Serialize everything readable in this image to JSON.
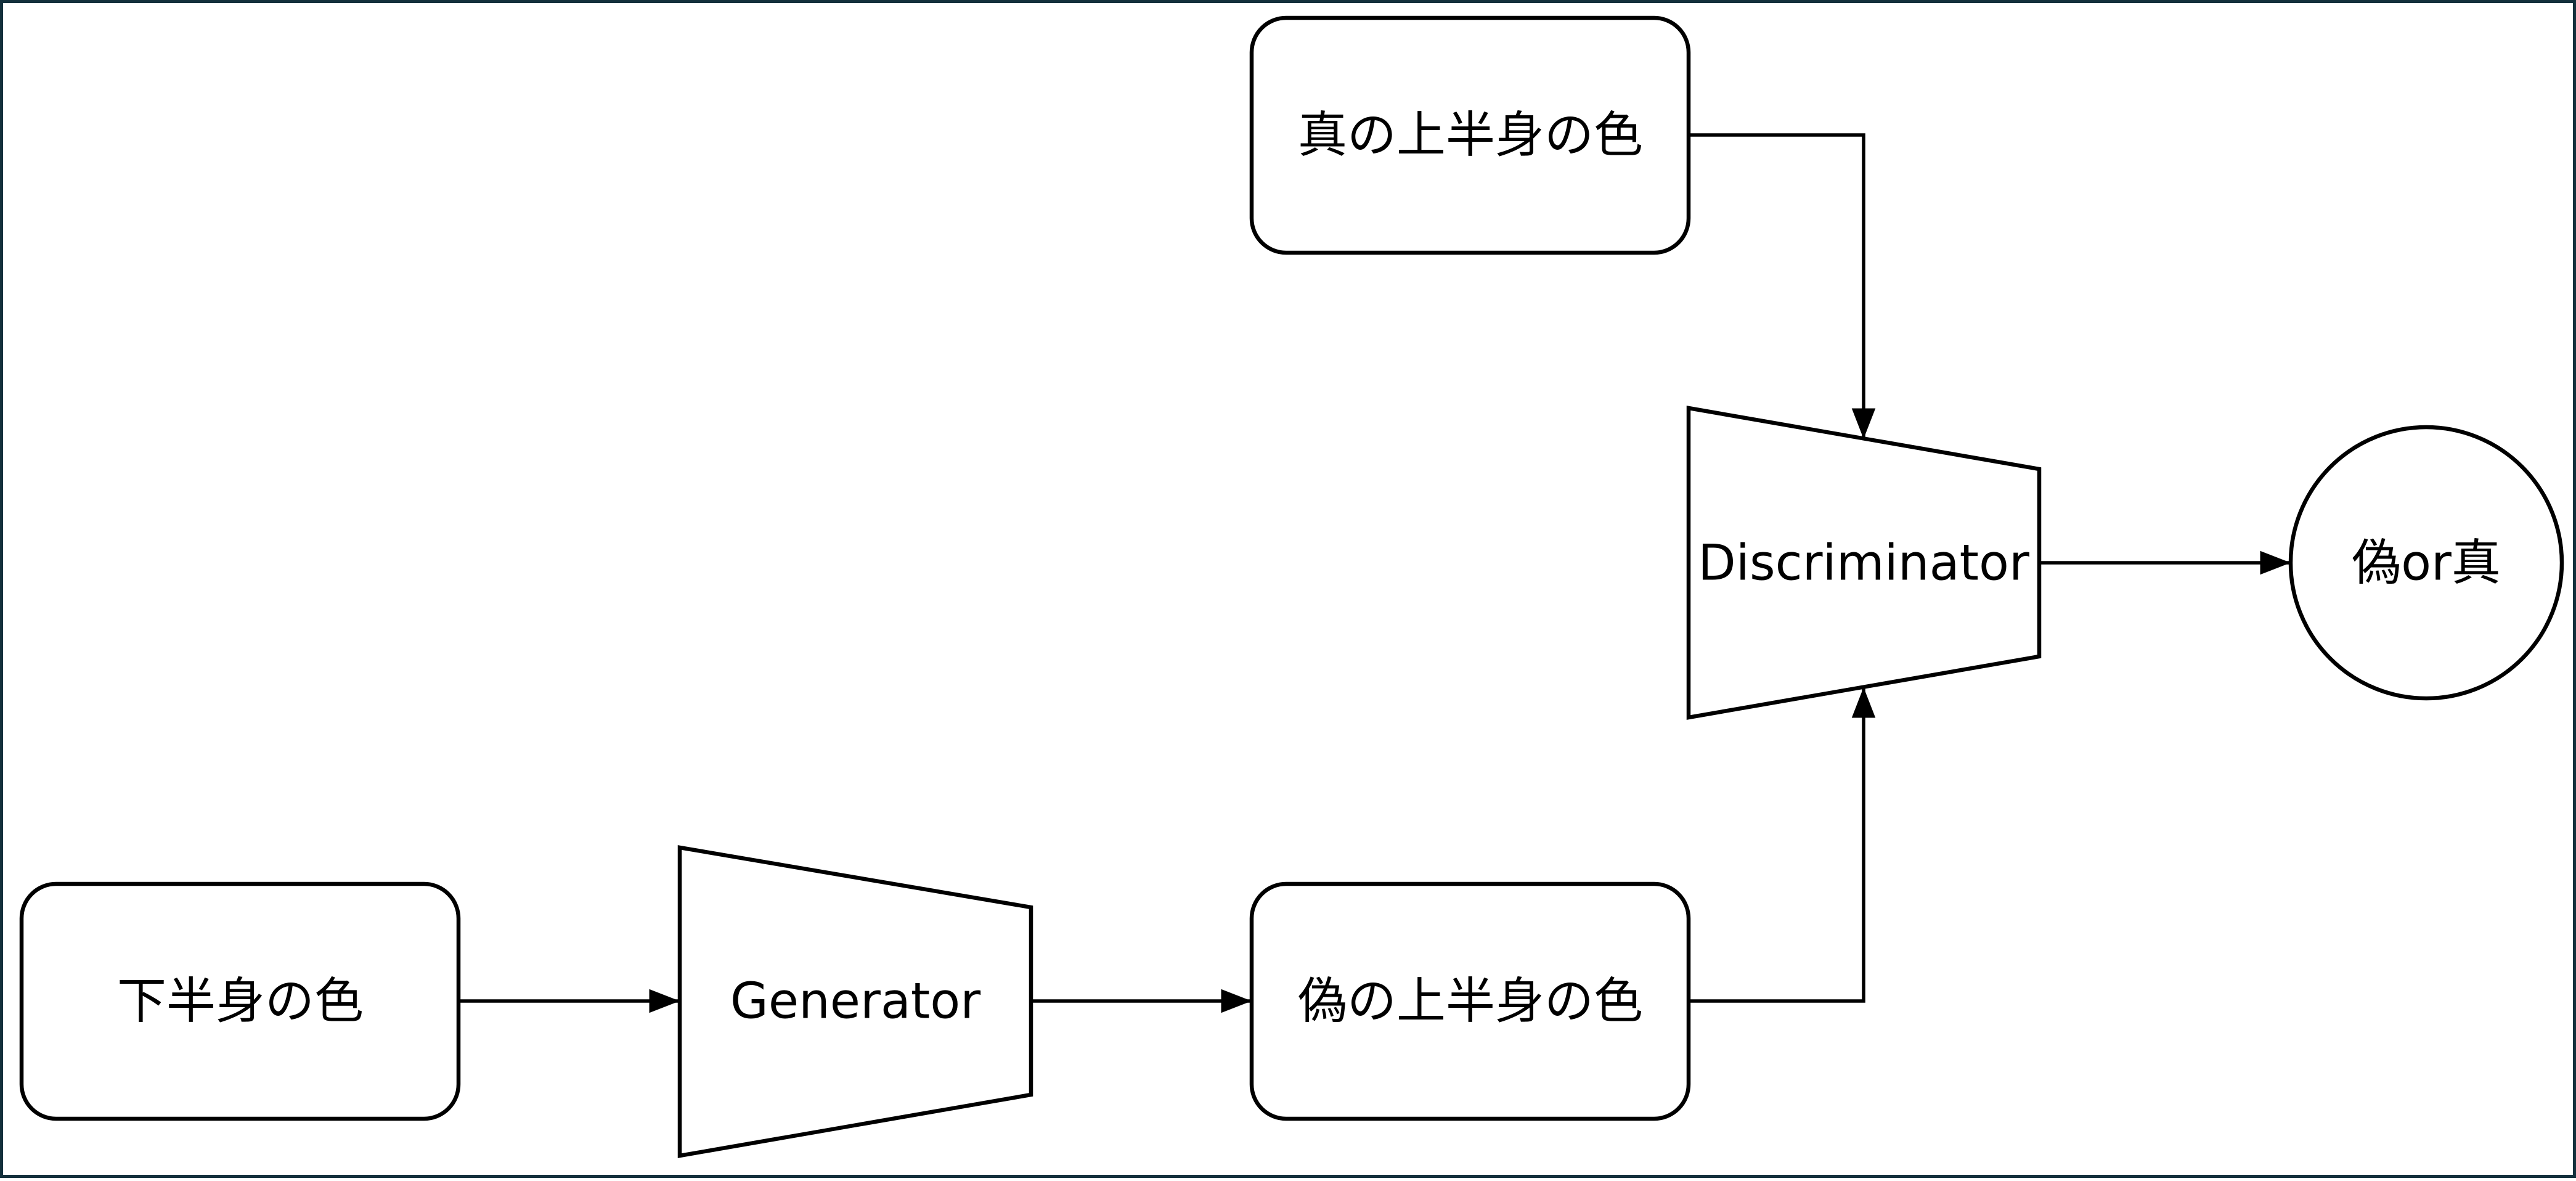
{
  "nodes": {
    "true_upper": "真の上半身の色",
    "lower_body": "下半身の色",
    "generator": "Generator",
    "fake_upper": "偽の上半身の色",
    "discriminator": "Discriminator",
    "output": "偽or真"
  }
}
